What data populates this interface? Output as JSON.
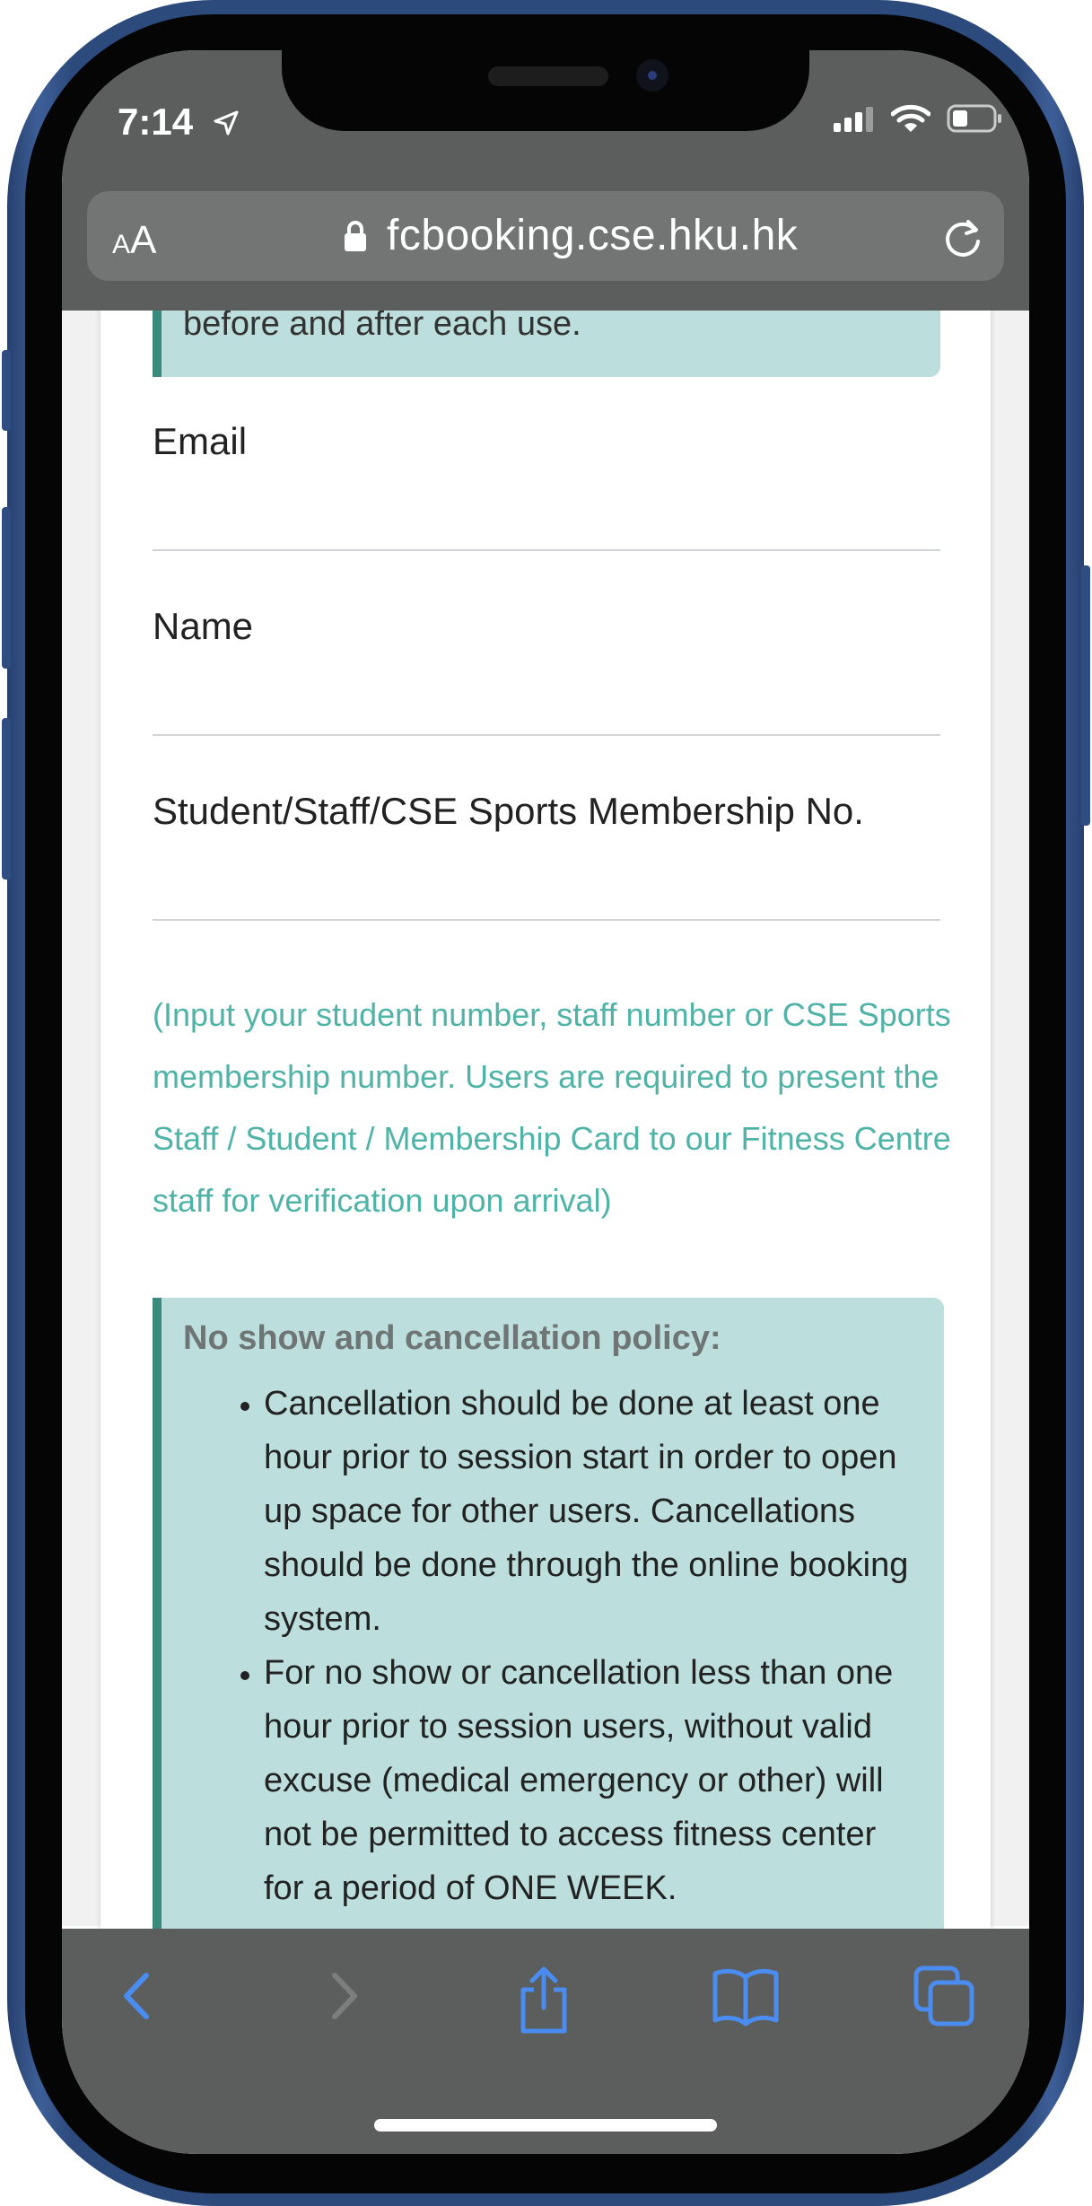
{
  "status_bar": {
    "time": "7:14"
  },
  "browser": {
    "text_size_label_small": "A",
    "text_size_label_large": "A",
    "url": "fcbooking.cse.hku.hk"
  },
  "page": {
    "info_top_text": "before and after each use.",
    "fields": {
      "email_label": "Email",
      "name_label": "Name",
      "membership_label": "Student/Staff/CSE Sports Membership No."
    },
    "hint": "(Input your student number, staff number or CSE Sports membership number. Users are required to present the Staff / Student / Membership Card to our Fitness Centre staff for verification upon arrival)",
    "policy": {
      "title": "No show and cancellation policy:",
      "items": [
        "Cancellation should be done at least one hour prior to session start in order to open up space for other users. Cancellations should be done through the online booking system.",
        "For no show or cancellation less than one hour prior to session users, without valid excuse (medical emergency or other) will not be permitted to access fitness center for a period of ONE WEEK."
      ]
    }
  },
  "toolbar": {
    "back_icon": "chevron-left-icon",
    "forward_icon": "chevron-right-icon",
    "share_icon": "share-icon",
    "bookmarks_icon": "book-icon",
    "tabs_icon": "tabs-icon"
  },
  "colors": {
    "accent": "#4a8cf0",
    "hint_text": "#4fb3a7",
    "info_box_bg": "#bcdedc",
    "info_box_border": "#3b8a7d",
    "chrome_bg": "#5b5e5d"
  }
}
